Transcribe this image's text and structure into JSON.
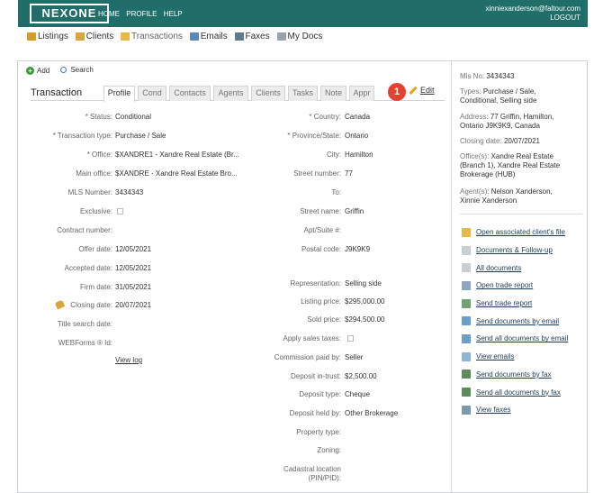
{
  "header": {
    "logo": "NEXONE",
    "nav": [
      "HOME",
      "PROFILE",
      "HELP"
    ],
    "user_email": "xinniexanderson@faltour.com",
    "logout": "LOGOUT"
  },
  "main_nav": [
    {
      "label": "Listings",
      "icon": "house-icon",
      "color": "#d49a2a"
    },
    {
      "label": "Clients",
      "icon": "clients-icon",
      "color": "#d9a43a"
    },
    {
      "label": "Transactions",
      "icon": "folder-icon",
      "color": "#e6b84a"
    },
    {
      "label": "Emails",
      "icon": "envelope-icon",
      "color": "#5b87b8"
    },
    {
      "label": "Faxes",
      "icon": "fax-icon",
      "color": "#607a90"
    },
    {
      "label": "My Docs",
      "icon": "docs-icon",
      "color": "#9aa3ab"
    }
  ],
  "actions": {
    "add": "Add",
    "search": "Search"
  },
  "tabs": {
    "title": "Transaction",
    "items": [
      "Profile",
      "Cond",
      "Contacts",
      "Agents",
      "Clients",
      "Tasks",
      "Note",
      "Appr"
    ],
    "active": "Profile"
  },
  "callout_number": "1",
  "edit_label": "Edit",
  "left_fields": [
    {
      "label": "* Status:",
      "value": "Conditional"
    },
    {
      "label": "* Transaction type:",
      "value": "Purchase / Sale"
    },
    {
      "label": "* Office:",
      "value": "$XANDRE1 - Xandre Real Estate (Br..."
    },
    {
      "label": "Main office:",
      "value": "$XANDRE - Xandre Real Estate Bro..."
    },
    {
      "label": "MLS Number:",
      "value": "3434343"
    },
    {
      "label": "Exclusive:",
      "value": ""
    },
    {
      "label": "Contract number:",
      "value": ""
    },
    {
      "label": "Offer date:",
      "value": "12/05/2021"
    },
    {
      "label": "Accepted date:",
      "value": "12/05/2021"
    },
    {
      "label": "Firm date:",
      "value": "31/05/2021"
    },
    {
      "label": "Closing date:",
      "value": "20/07/2021"
    },
    {
      "label": "Title search date:",
      "value": ""
    },
    {
      "label": "WEBForms ® Id:",
      "value": ""
    }
  ],
  "view_log": "View log",
  "right_fields": [
    {
      "label": "* Country:",
      "value": "Canada"
    },
    {
      "label": "* Province/State:",
      "value": "Ontario"
    },
    {
      "label": "City:",
      "value": "Hamilton"
    },
    {
      "label": "Street number:",
      "value": "77"
    },
    {
      "label": "To:",
      "value": ""
    },
    {
      "label": "Street name:",
      "value": "Griffin"
    },
    {
      "label": "Apt/Suite #:",
      "value": ""
    },
    {
      "label": "Postal code:",
      "value": "J9K9K9"
    },
    {
      "label": "Representation:",
      "value": "Selling side"
    },
    {
      "label": "Listing price:",
      "value": "$295,000.00"
    },
    {
      "label": "Sold price:",
      "value": "$294,500.00"
    },
    {
      "label": "Apply sales taxes:",
      "value": ""
    },
    {
      "label": "Commission paid by:",
      "value": "Seller"
    },
    {
      "label": "Deposit in-trust:",
      "value": "$2,500.00"
    },
    {
      "label": "Deposit type:",
      "value": "Cheque"
    },
    {
      "label": "Deposit held by:",
      "value": "Other Brokerage"
    },
    {
      "label": "Property type:",
      "value": ""
    },
    {
      "label": "Zoning:",
      "value": ""
    },
    {
      "label": "Cadastral location",
      "value": ""
    },
    {
      "label": "(PIN/PID):",
      "value": ""
    }
  ],
  "summary": {
    "mls_label": "Mls No:",
    "mls": "3434343",
    "types_label": "Types:",
    "types_line1": "Purchase / Sale,",
    "types_line2": "Conditional, Selling side",
    "address_label": "Address:",
    "address_line1": "77 Griffin, Hamilton,",
    "address_line2": "Ontario J9K9K9, Canada",
    "closing_label": "Closing date:",
    "closing": "20/07/2021",
    "offices_label": "Office(s):",
    "offices_line1": "Xandre Real Estate",
    "offices_line2": "(Branch 1), Xandre Real Estate",
    "offices_line3": "Brokerage (HUB)",
    "agents_label": "Agent(s):",
    "agents_line1": "Nelson Xanderson,",
    "agents_line2": "Xinnie Xanderson"
  },
  "side_links": [
    {
      "label": "Open associated client's file",
      "icon": "folder-open-icon",
      "color": "#e6b84a"
    },
    {
      "label": "Documents & Follow-up",
      "icon": "document-icon",
      "color": "#c9ced3"
    },
    {
      "label": "All documents",
      "icon": "documents-icon",
      "color": "#c9ced3"
    },
    {
      "label": "Open trade report",
      "icon": "report-icon",
      "color": "#8fa6c0"
    },
    {
      "label": "Send trade report",
      "icon": "send-report-icon",
      "color": "#6fa36f"
    },
    {
      "label": "Send documents by email",
      "icon": "email-send-icon",
      "color": "#6a9fcc"
    },
    {
      "label": "Send all documents by email",
      "icon": "email-send-all-icon",
      "color": "#6a9fcc"
    },
    {
      "label": "View emails",
      "icon": "view-emails-icon",
      "color": "#8fb4d6"
    },
    {
      "label": "Send documents by fax",
      "icon": "fax-send-icon",
      "color": "#5f8c5f"
    },
    {
      "label": "Send all documents by fax",
      "icon": "fax-send-all-icon",
      "color": "#5f8c5f"
    },
    {
      "label": "View faxes",
      "icon": "view-faxes-icon",
      "color": "#7d97ad"
    }
  ]
}
